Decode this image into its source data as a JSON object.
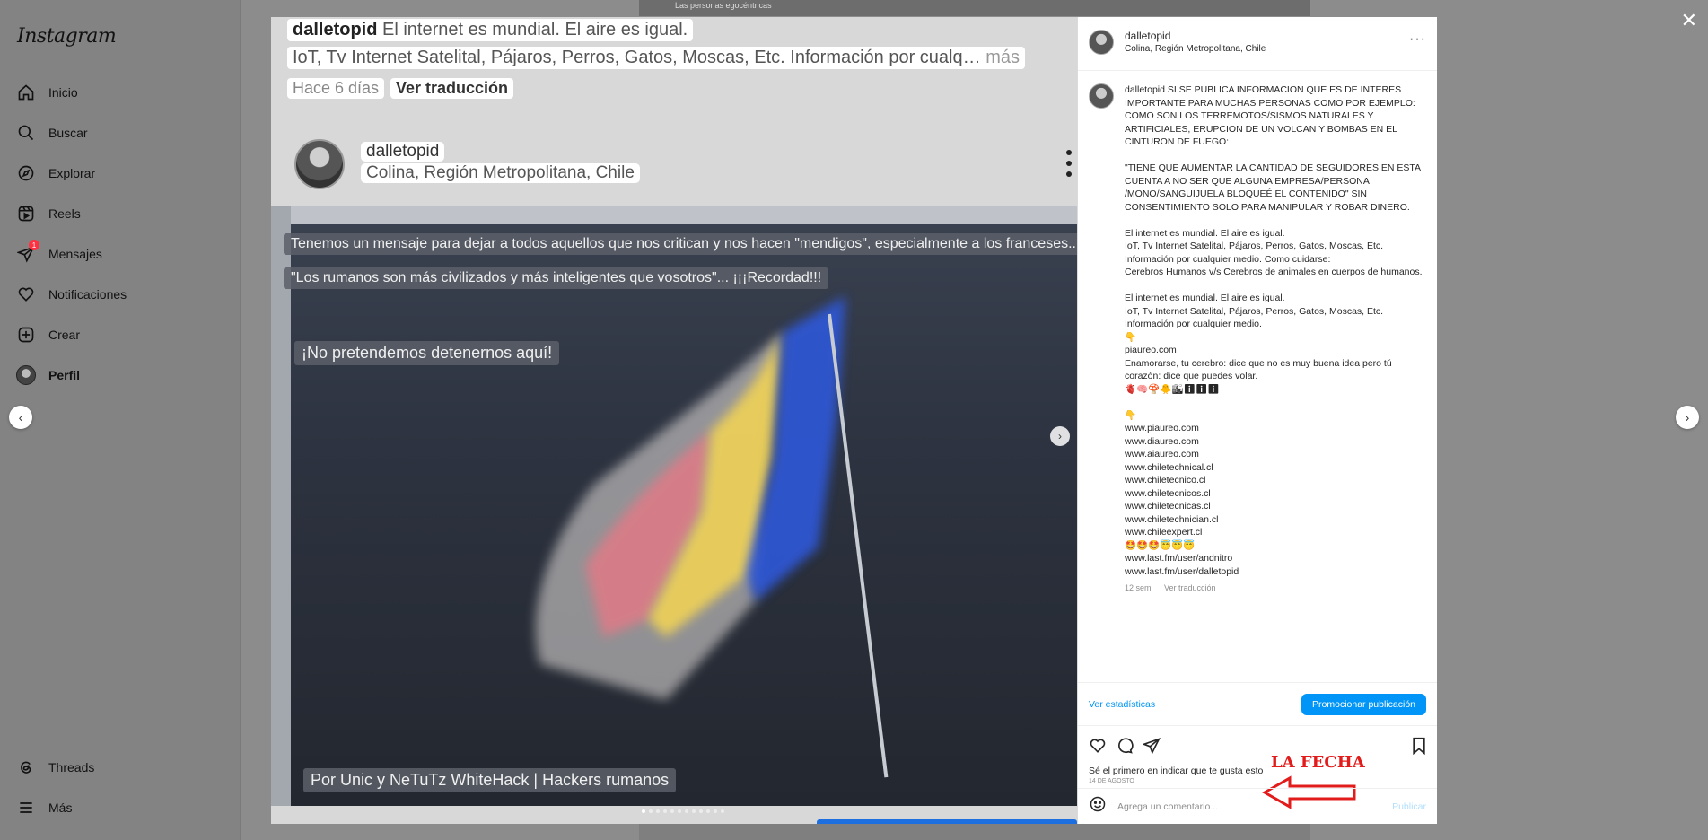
{
  "sidebar": {
    "logo": "Instagram",
    "items": [
      {
        "label": "Inicio",
        "icon": "home-icon"
      },
      {
        "label": "Buscar",
        "icon": "search-icon"
      },
      {
        "label": "Explorar",
        "icon": "compass-icon"
      },
      {
        "label": "Reels",
        "icon": "reels-icon"
      },
      {
        "label": "Mensajes",
        "icon": "messenger-icon",
        "badge": "1"
      },
      {
        "label": "Notificaciones",
        "icon": "heart-icon"
      },
      {
        "label": "Crear",
        "icon": "plus-square-icon"
      },
      {
        "label": "Perfil",
        "icon": "avatar"
      }
    ],
    "bottom": [
      {
        "label": "Threads",
        "icon": "threads-icon"
      },
      {
        "label": "Más",
        "icon": "menu-icon"
      }
    ]
  },
  "background_peek": "Las personas egocéntricas",
  "media": {
    "caption_user": "dalletopid",
    "caption_first": "El internet es mundial. El aire es igual.",
    "caption_second": "IoT, Tv Internet Satelital, Pájaros, Perros, Gatos, Moscas, Etc. Información por cualq…",
    "caption_more": "más",
    "time": "Hace 6 días",
    "translate": "Ver traducción",
    "inner_user": "dalletopid",
    "inner_location": "Colina, Región Metropolitana, Chile",
    "overlay1": "Tenemos un mensaje para dejar a todos aquellos que nos critican y nos hacen \"mendigos\", especialmente a los franceses...",
    "overlay2": "\"Los rumanos son más civilizados y más inteligentes que vosotros\"... ¡¡¡Recordad!!!",
    "overlay3": "¡No pretendemos detenernos aquí!",
    "overlay4": "Por Unic y NeTuTz WhiteHack | Hackers rumanos"
  },
  "panel": {
    "username": "dalletopid",
    "location": "Colina, Región Metropolitana, Chile",
    "more": "···",
    "caption_user": "dalletopid",
    "caption_body": " SI SE PUBLICA INFORMACION QUE ES DE INTERES IMPORTANTE PARA MUCHAS PERSONAS COMO POR EJEMPLO: COMO SON LOS TERREMOTOS/SISMOS NATURALES Y ARTIFICIALES, ERUPCION DE UN VOLCAN Y BOMBAS EN EL CINTURON DE FUEGO:\n\n\"TIENE QUE AUMENTAR LA CANTIDAD DE SEGUIDORES EN ESTA CUENTA A NO SER QUE ALGUNA EMPRESA/PERSONA /MONO/SANGUIJUELA BLOQUEÉ EL CONTENIDO\" SIN CONSENTIMIENTO SOLO PARA MANIPULAR Y ROBAR DINERO.\n\nEl internet es mundial. El aire es igual.\nIoT, Tv Internet Satelital, Pájaros, Perros, Gatos, Moscas, Etc. Información por cualquier medio. Como cuidarse:\nCerebros Humanos v/s Cerebros de animales en cuerpos de humanos.\n\nEl internet es mundial. El aire es igual.\nIoT, Tv Internet Satelital, Pájaros, Perros, Gatos, Moscas, Etc. Información por cualquier medio.\n👇\npiaureo.com\nEnamorarse, tu cerebro: dice que no es muy buena idea pero tú corazón: dice que puedes volar.\n🫀🧠🍄🐥🏙ℹℹℹ\n\n👇\nwww.piaureo.com\nwww.diaureo.com\nwww.aiaureo.com\nwww.chiletechnical.cl\nwww.chiletecnico.cl\nwww.chiletecnicos.cl\nwww.chiletecnicas.cl\nwww.chiletechnician.cl\nwww.chileexpert.cl\n🤩🤩🤩😇😇😇\nwww.last.fm/user/andnitro\nwww.last.fm/user/dalletopid",
    "age": "12 sem",
    "translate": "Ver traducción",
    "stats": "Ver estadísticas",
    "promote": "Promocionar publicación",
    "likes": "Sé el primero en indicar que te gusta esto",
    "date": "14 DE AGOSTO",
    "annotation": "LA FECHA",
    "comment_placeholder": "Agrega un comentario...",
    "publish": "Publicar"
  },
  "colors": {
    "accent": "#0095f6",
    "annotation": "#e21b1b",
    "badge": "#ff3040"
  }
}
